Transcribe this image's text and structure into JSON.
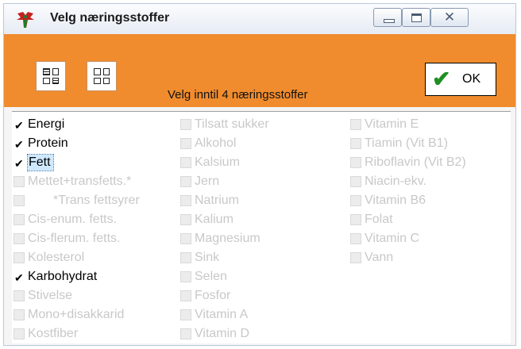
{
  "window": {
    "title": "Velg næringsstoffer",
    "close_glyph": "✕"
  },
  "toolbar": {
    "label": "Velg inntil 4 næringsstoffer",
    "ok_label": "OK"
  },
  "columns": [
    [
      {
        "label": "Energi",
        "checked": true
      },
      {
        "label": "Protein",
        "checked": true
      },
      {
        "label": "Fett",
        "checked": true,
        "focused": true
      },
      {
        "label": "Mettet+transfetts.*",
        "checked": false
      },
      {
        "label": "*Trans fettsyrer",
        "checked": false,
        "indent": true
      },
      {
        "label": "Cis-enum. fetts.",
        "checked": false
      },
      {
        "label": "Cis-flerum. fetts.",
        "checked": false
      },
      {
        "label": "Kolesterol",
        "checked": false
      },
      {
        "label": "Karbohydrat",
        "checked": true
      },
      {
        "label": "Stivelse",
        "checked": false
      },
      {
        "label": "Mono+disakkarid",
        "checked": false
      },
      {
        "label": "Kostfiber",
        "checked": false
      }
    ],
    [
      {
        "label": "Tilsatt sukker",
        "checked": false
      },
      {
        "label": "Alkohol",
        "checked": false
      },
      {
        "label": "Kalsium",
        "checked": false
      },
      {
        "label": "Jern",
        "checked": false
      },
      {
        "label": "Natrium",
        "checked": false
      },
      {
        "label": "Kalium",
        "checked": false
      },
      {
        "label": "Magnesium",
        "checked": false
      },
      {
        "label": "Sink",
        "checked": false
      },
      {
        "label": "Selen",
        "checked": false
      },
      {
        "label": "Fosfor",
        "checked": false
      },
      {
        "label": "Vitamin A",
        "checked": false
      },
      {
        "label": "Vitamin D",
        "checked": false
      }
    ],
    [
      {
        "label": "Vitamin E",
        "checked": false
      },
      {
        "label": "Tiamin (Vit B1)",
        "checked": false
      },
      {
        "label": "Riboflavin (Vit B2)",
        "checked": false
      },
      {
        "label": "Niacin-ekv.",
        "checked": false
      },
      {
        "label": "Vitamin B6",
        "checked": false
      },
      {
        "label": "Folat",
        "checked": false
      },
      {
        "label": "Vitamin C",
        "checked": false
      },
      {
        "label": "Vann",
        "checked": false
      }
    ]
  ],
  "colors": {
    "toolbar": "#f08c2e",
    "ok_check": "#1e8f23",
    "focus": "#cfe9ff"
  }
}
